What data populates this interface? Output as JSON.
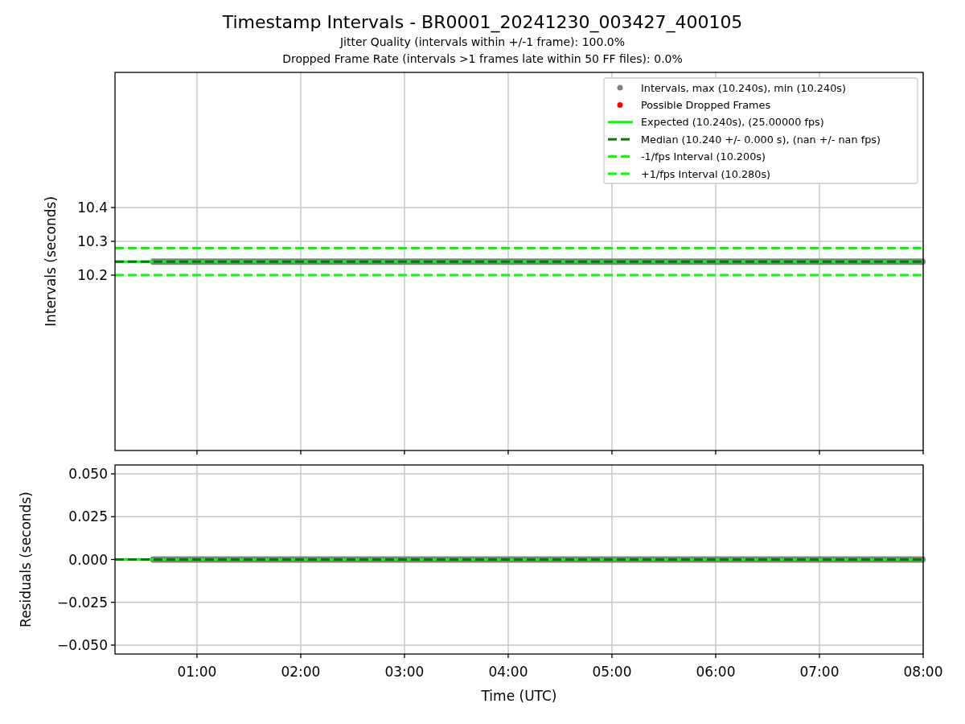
{
  "figure": {
    "title": "Timestamp Intervals - BR0001_20241230_003427_400105",
    "subtitles": [
      "Jitter Quality (intervals within +/-1 frame): 100.0%",
      "Dropped Frame Rate (intervals >1 frames late within 50 FF files): 0.0%"
    ]
  },
  "intervals_panel": {
    "chart_data": {
      "type": "line",
      "ylabel": "Intervals (seconds)",
      "grid": true,
      "legend": "upper right",
      "x": [
        0.21,
        0.58,
        8.0
      ],
      "xlim": [
        0.21,
        8.0
      ],
      "ylim": [
        9.681,
        10.8
      ],
      "yticks": [
        {
          "value": 10.2,
          "label": "10.2"
        },
        {
          "value": 10.3,
          "label": "10.3"
        },
        {
          "value": 10.4,
          "label": "10.4"
        }
      ],
      "series": [
        {
          "name": "Intervals, max (10.240s), min (10.240s)",
          "color": "#808080",
          "line_style": "markers",
          "values": [
            null,
            10.24,
            10.24
          ]
        },
        {
          "name": "Possible Dropped Frames",
          "color": "#ff0000",
          "line_style": "markers",
          "values": [
            null,
            null,
            null
          ]
        },
        {
          "name": "Expected (10.240s), (25.00000 fps)",
          "color": "#00ff00",
          "line_style": "solid",
          "values": [
            10.24,
            10.24,
            10.24
          ]
        },
        {
          "name": "Median (10.240 +/- 0.000 s), (nan +/- nan fps)",
          "color": "#008000",
          "line_style": "dashed",
          "values": [
            10.24,
            10.24,
            10.24
          ]
        },
        {
          "name": "-1/fps Interval (10.200s)",
          "color": "#00ff00",
          "line_style": "dashed",
          "values": [
            10.2,
            10.2,
            10.2
          ]
        },
        {
          "name": "+1/fps Interval (10.280s)",
          "color": "#00ff00",
          "line_style": "dashed",
          "values": [
            10.28,
            10.28,
            10.28
          ]
        }
      ]
    }
  },
  "residuals_panel": {
    "chart_data": {
      "type": "line",
      "xlabel": "Time (UTC)",
      "ylabel": "Residuals (seconds)",
      "grid": true,
      "x": [
        0.21,
        0.58,
        8.0
      ],
      "xlim": [
        0.21,
        8.0
      ],
      "ylim": [
        -0.0552,
        0.0552
      ],
      "xticks": [
        {
          "value": 1,
          "label": "01:00"
        },
        {
          "value": 2,
          "label": "02:00"
        },
        {
          "value": 3,
          "label": "03:00"
        },
        {
          "value": 4,
          "label": "04:00"
        },
        {
          "value": 5,
          "label": "05:00"
        },
        {
          "value": 6,
          "label": "06:00"
        },
        {
          "value": 7,
          "label": "07:00"
        },
        {
          "value": 8,
          "label": "08:00"
        }
      ],
      "yticks": [
        {
          "value": 0.05,
          "label": "0.050"
        },
        {
          "value": 0.025,
          "label": "0.025"
        },
        {
          "value": 0,
          "label": "0.000"
        },
        {
          "value": -0.025,
          "label": "−0.025"
        },
        {
          "value": -0.05,
          "label": "−0.050"
        }
      ],
      "series": [
        {
          "color": "#808080",
          "line_style": "markers",
          "values": [
            null,
            0,
            0
          ]
        },
        {
          "color": "#00ff00",
          "line_style": "solid",
          "values": [
            0,
            0,
            0
          ]
        },
        {
          "color": "#008000",
          "line_style": "dashed",
          "values": [
            0,
            0,
            0
          ]
        }
      ]
    }
  }
}
